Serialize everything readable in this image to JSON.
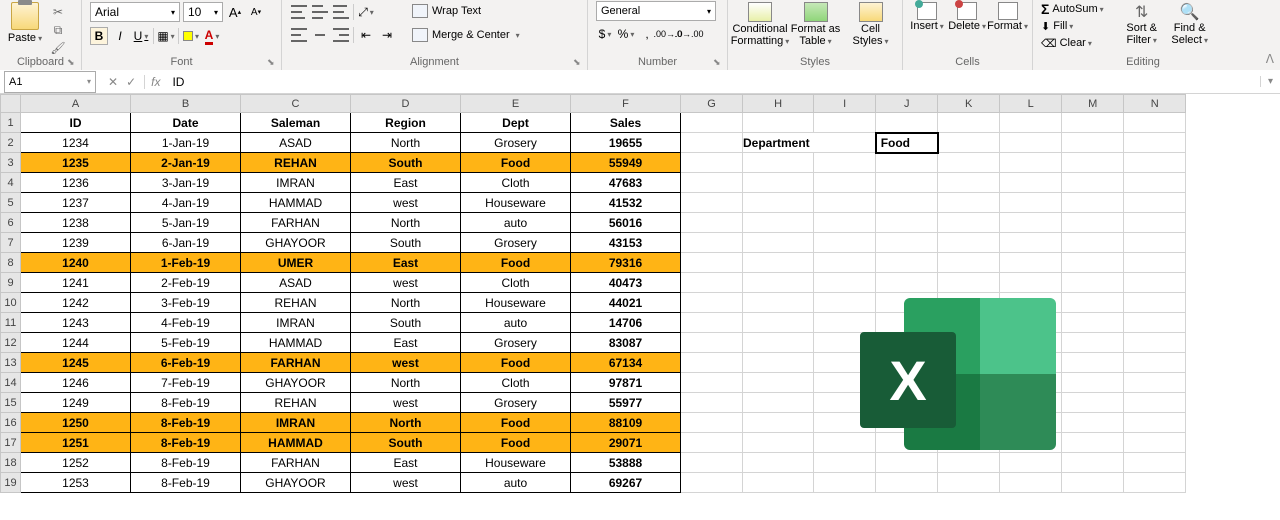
{
  "ribbon": {
    "clipboard": {
      "label": "Clipboard",
      "paste": "Paste"
    },
    "font": {
      "label": "Font",
      "name": "Arial",
      "size": "10",
      "bold": "B",
      "italic": "I",
      "underline": "U",
      "increase": "A",
      "decrease": "A"
    },
    "alignment": {
      "label": "Alignment",
      "wrap": "Wrap Text",
      "merge": "Merge & Center"
    },
    "number": {
      "label": "Number",
      "format": "General",
      "currency": "$",
      "percent": "%",
      "comma": ","
    },
    "styles": {
      "label": "Styles",
      "conditional": "Conditional Formatting",
      "formatas": "Format as Table",
      "cellstyles": "Cell Styles"
    },
    "cells": {
      "label": "Cells",
      "insert": "Insert",
      "delete": "Delete",
      "format": "Format"
    },
    "editing": {
      "label": "Editing",
      "autosum": "AutoSum",
      "fill": "Fill",
      "clear": "Clear",
      "sortfilter": "Sort & Filter",
      "findselect": "Find & Select"
    }
  },
  "formula_bar": {
    "name_box": "A1",
    "fx": "fx",
    "value": "ID"
  },
  "columns": [
    "A",
    "B",
    "C",
    "D",
    "E",
    "F",
    "G",
    "H",
    "I",
    "J",
    "K",
    "L",
    "M",
    "N"
  ],
  "table": {
    "headers": [
      "ID",
      "Date",
      "Saleman",
      "Region",
      "Dept",
      "Sales"
    ],
    "rows": [
      {
        "id": "1234",
        "date": "1-Jan-19",
        "sale": "ASAD",
        "region": "North",
        "dept": "Grosery",
        "sales": "19655",
        "hl": false
      },
      {
        "id": "1235",
        "date": "2-Jan-19",
        "sale": "REHAN",
        "region": "South",
        "dept": "Food",
        "sales": "55949",
        "hl": true
      },
      {
        "id": "1236",
        "date": "3-Jan-19",
        "sale": "IMRAN",
        "region": "East",
        "dept": "Cloth",
        "sales": "47683",
        "hl": false
      },
      {
        "id": "1237",
        "date": "4-Jan-19",
        "sale": "HAMMAD",
        "region": "west",
        "dept": "Houseware",
        "sales": "41532",
        "hl": false
      },
      {
        "id": "1238",
        "date": "5-Jan-19",
        "sale": "FARHAN",
        "region": "North",
        "dept": "auto",
        "sales": "56016",
        "hl": false
      },
      {
        "id": "1239",
        "date": "6-Jan-19",
        "sale": "GHAYOOR",
        "region": "South",
        "dept": "Grosery",
        "sales": "43153",
        "hl": false
      },
      {
        "id": "1240",
        "date": "1-Feb-19",
        "sale": "UMER",
        "region": "East",
        "dept": "Food",
        "sales": "79316",
        "hl": true
      },
      {
        "id": "1241",
        "date": "2-Feb-19",
        "sale": "ASAD",
        "region": "west",
        "dept": "Cloth",
        "sales": "40473",
        "hl": false
      },
      {
        "id": "1242",
        "date": "3-Feb-19",
        "sale": "REHAN",
        "region": "North",
        "dept": "Houseware",
        "sales": "44021",
        "hl": false
      },
      {
        "id": "1243",
        "date": "4-Feb-19",
        "sale": "IMRAN",
        "region": "South",
        "dept": "auto",
        "sales": "14706",
        "hl": false
      },
      {
        "id": "1244",
        "date": "5-Feb-19",
        "sale": "HAMMAD",
        "region": "East",
        "dept": "Grosery",
        "sales": "83087",
        "hl": false
      },
      {
        "id": "1245",
        "date": "6-Feb-19",
        "sale": "FARHAN",
        "region": "west",
        "dept": "Food",
        "sales": "67134",
        "hl": true
      },
      {
        "id": "1246",
        "date": "7-Feb-19",
        "sale": "GHAYOOR",
        "region": "North",
        "dept": "Cloth",
        "sales": "97871",
        "hl": false
      },
      {
        "id": "1249",
        "date": "8-Feb-19",
        "sale": "REHAN",
        "region": "west",
        "dept": "Grosery",
        "sales": "55977",
        "hl": false
      },
      {
        "id": "1250",
        "date": "8-Feb-19",
        "sale": "IMRAN",
        "region": "North",
        "dept": "Food",
        "sales": "88109",
        "hl": true
      },
      {
        "id": "1251",
        "date": "8-Feb-19",
        "sale": "HAMMAD",
        "region": "South",
        "dept": "Food",
        "sales": "29071",
        "hl": true
      },
      {
        "id": "1252",
        "date": "8-Feb-19",
        "sale": "FARHAN",
        "region": "East",
        "dept": "Houseware",
        "sales": "53888",
        "hl": false
      },
      {
        "id": "1253",
        "date": "8-Feb-19",
        "sale": "GHAYOOR",
        "region": "west",
        "dept": "auto",
        "sales": "69267",
        "hl": false
      }
    ]
  },
  "department": {
    "label": "Department",
    "value": "Food"
  },
  "logo": {
    "letter": "X"
  }
}
